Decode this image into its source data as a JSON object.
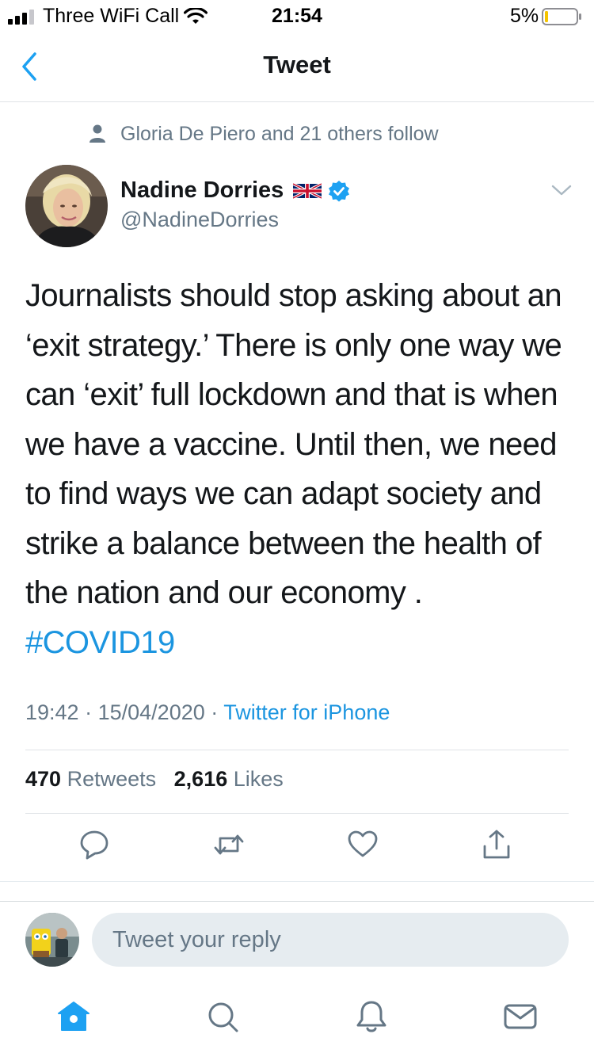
{
  "status_bar": {
    "carrier": "Three WiFi Call",
    "time": "21:54",
    "battery_percent": "5%"
  },
  "nav": {
    "title": "Tweet",
    "back_icon": "chevron-left-icon"
  },
  "social_context": {
    "text": "Gloria De Piero and 21 others follow",
    "icon": "person-icon"
  },
  "author": {
    "name": "Nadine Dorries",
    "handle": "@NadineDorries",
    "flag_icon": "uk-flag-icon",
    "verified_icon": "verified-badge-icon"
  },
  "tweet": {
    "text": "Journalists should stop asking about an ‘exit strategy.’ There is only one way we can ‘exit’ full lockdown and that is when we have a vaccine. Until then, we need to find ways we can adapt society and strike a balance between the health of the nation and our economy . ",
    "hashtag": "#COVID19",
    "time": "19:42",
    "date": "15/04/2020",
    "separator": "·",
    "source": "Twitter for iPhone"
  },
  "stats": {
    "retweets_count": "470",
    "retweets_label": "Retweets",
    "likes_count": "2,616",
    "likes_label": "Likes"
  },
  "actions": [
    "reply-icon",
    "retweet-icon",
    "like-icon",
    "share-icon"
  ],
  "reply": {
    "placeholder": "Tweet your reply"
  },
  "tabbar": [
    "home-icon",
    "search-icon",
    "notifications-icon",
    "messages-icon"
  ],
  "colors": {
    "accent": "#1da1f2",
    "link": "#1b95e0",
    "secondary_text": "#657786",
    "primary_text": "#14171a",
    "reply_box": "#e6ecf0"
  }
}
